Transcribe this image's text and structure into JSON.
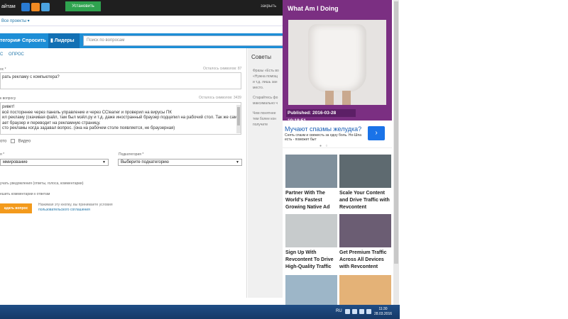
{
  "topbar": {
    "brand": "айтам",
    "install_label": "Установить",
    "close_label": "закрыть"
  },
  "subbar": {
    "projects_label": "Все проекты ▾"
  },
  "nav": {
    "categories": "тегории",
    "ask": "+ Спросить",
    "leaders": "Лидеры",
    "search_placeholder": "Поиск по вопросам"
  },
  "form": {
    "tab_question": "С",
    "tab_poll": "ОПРОС",
    "question_label": "ос *",
    "question_counter": "Осталось символов: 87",
    "question_value": "рать рекламу с компьютера?",
    "desc_label": "к вопросу",
    "desc_counter": "Осталось символов: 3439",
    "desc_lines": [
      "ривет!",
      "всё посторннее через панель управление и через CCleaner и проверил на вирусы ПК",
      "ил рекламу (скачивая файл, там был мэйл.ру и т.д. даже иностранный браузер подцепил на рабочий стол. Так же сам",
      "ает браузер и переводит на рекламную страницу.",
      "сто рекламы когда задавал вопрос. (она на рабочем столе появляется, не браузерная)"
    ],
    "desc_highlights": {
      "pk": "ПК",
      "mail": "мэйл.ру",
      "browser": "браузерная"
    },
    "media_photo": "ото",
    "media_video": "Видео",
    "category_label": "я *",
    "category_value": "ммирование",
    "subcategory_label": "Подкатегория *",
    "subcategory_value": "Выберите подкатегорию",
    "notify_text": "учать уведомления (ответы, голоса, комментарии)",
    "comments_text": "ешить комментарии к ответам",
    "submit_label": "адать вопрос",
    "terms_line1": "Нажимая эту кнопку, вы принимаете условия",
    "terms_link": "пользовательского соглашения"
  },
  "sidebar": {
    "title": "Советы",
    "lines": [
      "Фразы «Есть во",
      "«Нужна помощ",
      "и т.д. лишь зан",
      "место.",
      "",
      "Старайтесь фо",
      "максимально ч",
      "",
      "Чем понятнее",
      "тем более кон",
      "получите"
    ]
  },
  "ad": {
    "wam_title": "What Am I Doing",
    "published": "Published: 2016-03-28 10:18:51",
    "strip_title": "Мучают спазмы желудка?",
    "strip_sub": "Снять спазм и свежесть за одну боль. Но-Шпа есть - поможет быт",
    "strip_go": "›",
    "tiles": [
      {
        "caption": "Partner With The World's Fastest Growing Native Ad"
      },
      {
        "caption": "Scale Your Content and Drive Traffic with Revcontent"
      },
      {
        "caption": "Sign Up With Revcontent To Drive High-Quality Traffic"
      },
      {
        "caption": "Get Premium Traffic Across All Devices with Revcontent"
      },
      {
        "caption": ""
      },
      {
        "caption": ""
      }
    ]
  },
  "taskbar": {
    "lang": "RU",
    "time": "11:30",
    "date": "28.03.2016"
  },
  "colors": {
    "nav_blue": "#1d8ed6",
    "ad_purple": "#7b2f82",
    "submit_orange": "#f39a1c"
  }
}
